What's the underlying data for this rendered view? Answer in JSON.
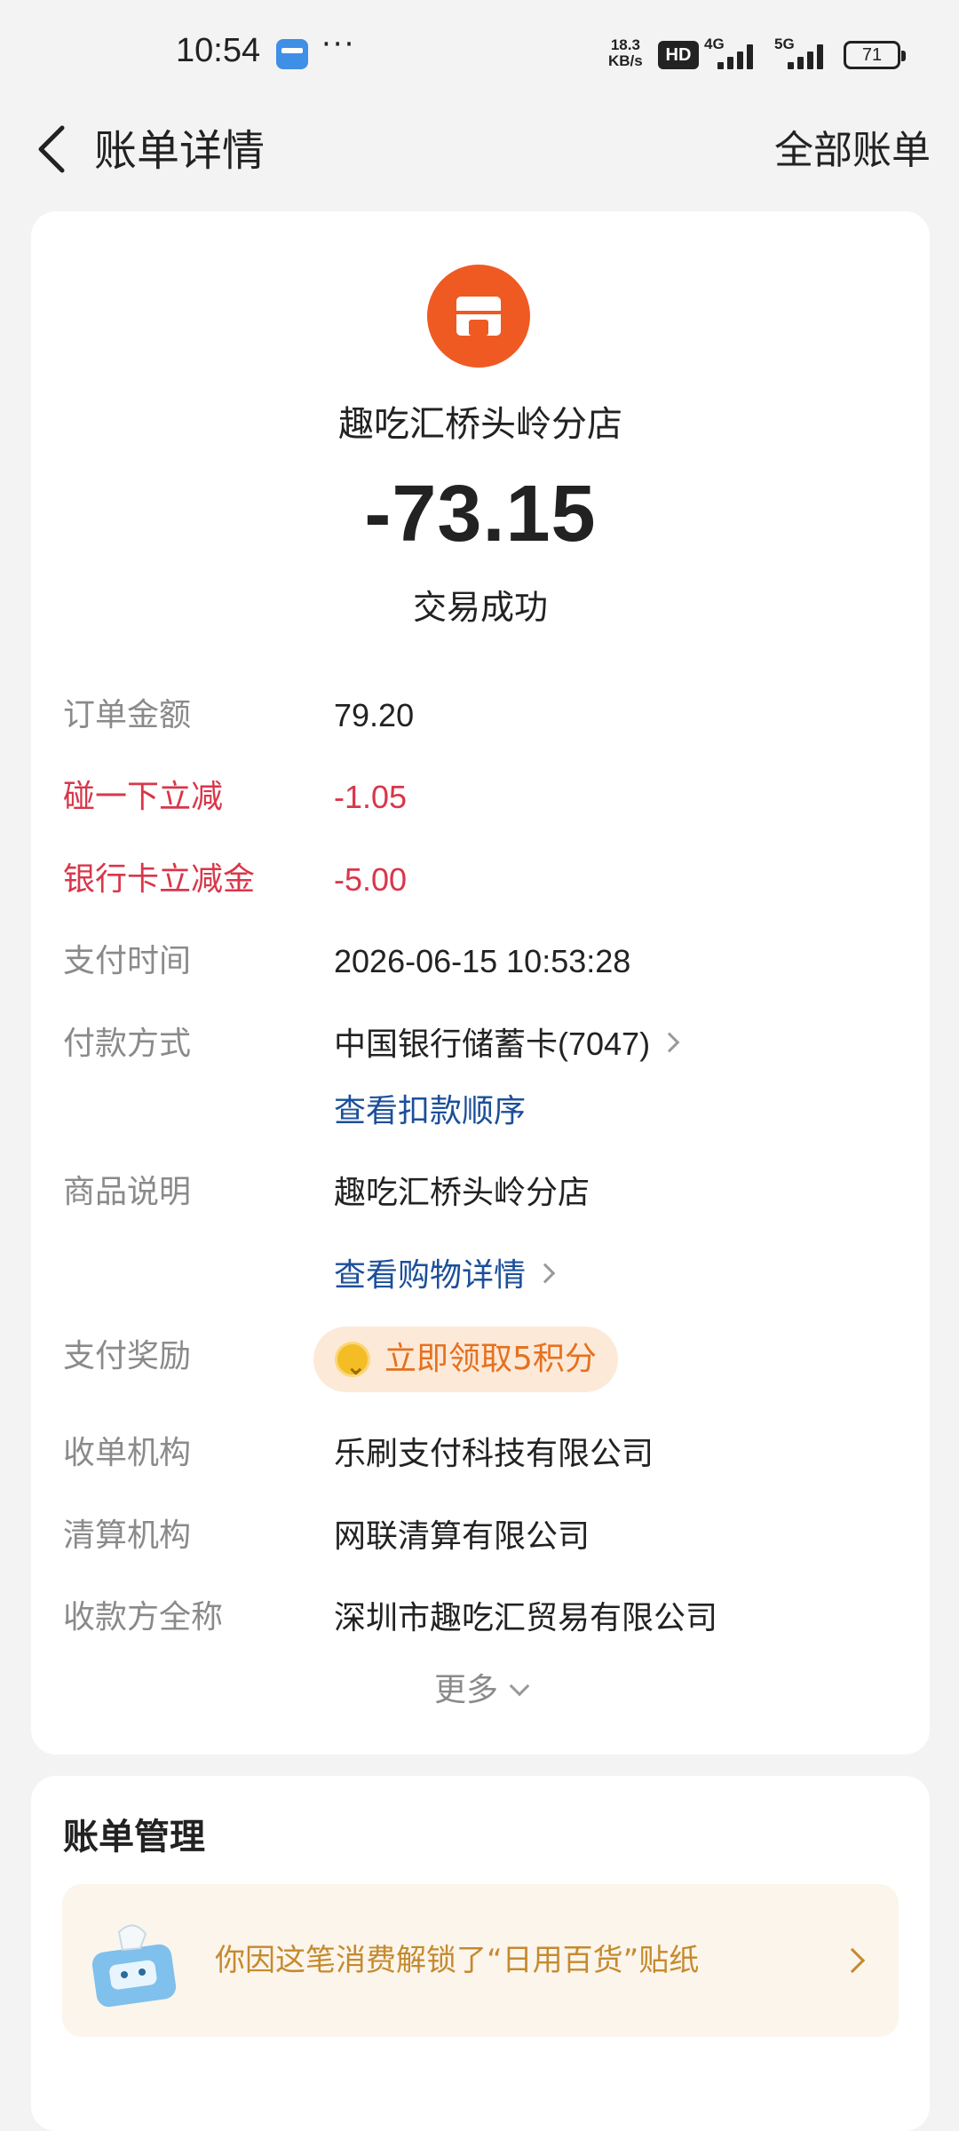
{
  "status_bar": {
    "time": "10:54",
    "net_speed_value": "18.3",
    "net_speed_unit": "KB/s",
    "hd_badge": "HD",
    "signal1_label": "4G",
    "signal2_label": "5G",
    "battery": "71"
  },
  "header": {
    "title": "账单详情",
    "all_bills": "全部账单"
  },
  "transaction": {
    "merchant": "趣吃汇桥头岭分店",
    "amount": "-73.15",
    "status": "交易成功"
  },
  "details": {
    "order_amount_label": "订单金额",
    "order_amount_value": "79.20",
    "tap_discount_label": "碰一下立减",
    "tap_discount_value": "-1.05",
    "bank_discount_label": "银行卡立减金",
    "bank_discount_value": "-5.00",
    "pay_time_label": "支付时间",
    "pay_time_value": "2026-06-15 10:53:28",
    "pay_method_label": "付款方式",
    "pay_method_value": "中国银行储蓄卡(7047)",
    "deduction_order_link": "查看扣款顺序",
    "goods_label": "商品说明",
    "goods_value": "趣吃汇桥头岭分店",
    "shopping_detail_link": "查看购物详情",
    "reward_label": "支付奖励",
    "reward_value": "立即领取5积分",
    "acquirer_label": "收单机构",
    "acquirer_value": "乐刷支付科技有限公司",
    "clearing_label": "清算机构",
    "clearing_value": "网联清算有限公司",
    "payee_label": "收款方全称",
    "payee_value": "深圳市趣吃汇贸易有限公司",
    "more": "更多"
  },
  "management": {
    "heading": "账单管理",
    "sticker_text": "你因这笔消费解锁了“日用百货”贴纸"
  },
  "colors": {
    "accent_red": "#d9364a",
    "link_blue": "#1c4f9a",
    "merchant_orange": "#ef5a22",
    "reward_orange": "#e5711f"
  }
}
